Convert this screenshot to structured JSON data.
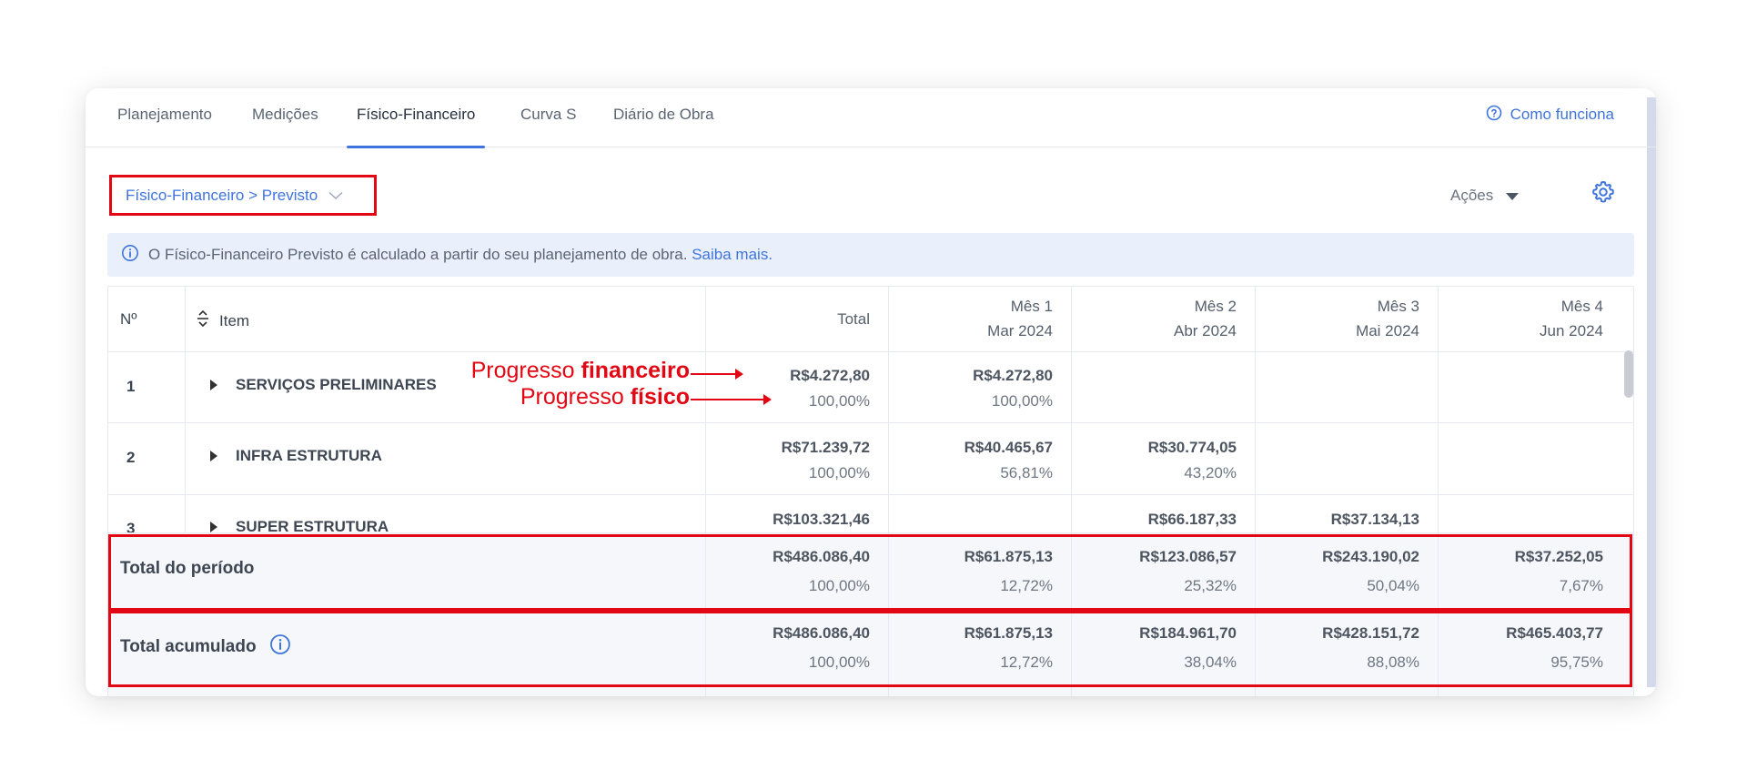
{
  "tabs": [
    {
      "label": "Planejamento"
    },
    {
      "label": "Medições"
    },
    {
      "label": "Físico-Financeiro"
    },
    {
      "label": "Curva S"
    },
    {
      "label": "Diário de Obra"
    }
  ],
  "active_tab": "Físico-Financeiro",
  "help_link": "Como funciona",
  "view_selector": "Físico-Financeiro > Previsto",
  "actions_label": "Ações",
  "banner": {
    "text": "O Físico-Financeiro Previsto é calculado a partir do seu planejamento de obra.",
    "link": "Saiba mais."
  },
  "table": {
    "headers": {
      "num": "Nº",
      "item": "Item",
      "total": "Total",
      "months": [
        {
          "line1": "Mês 1",
          "line2": "Mar 2024"
        },
        {
          "line1": "Mês 2",
          "line2": "Abr 2024"
        },
        {
          "line1": "Mês 3",
          "line2": "Mai 2024"
        },
        {
          "line1": "Mês 4",
          "line2": "Jun 2024"
        }
      ]
    },
    "rows": [
      {
        "num": "1",
        "name": "SERVIÇOS PRELIMINARES",
        "total": {
          "value": "R$4.272,80",
          "pct": "100,00%"
        },
        "months": [
          {
            "value": "R$4.272,80",
            "pct": "100,00%"
          },
          null,
          null,
          null
        ]
      },
      {
        "num": "2",
        "name": "INFRA ESTRUTURA",
        "total": {
          "value": "R$71.239,72",
          "pct": "100,00%"
        },
        "months": [
          {
            "value": "R$40.465,67",
            "pct": "56,81%"
          },
          {
            "value": "R$30.774,05",
            "pct": "43,20%"
          },
          null,
          null
        ]
      },
      {
        "num": "3",
        "name": "SUPER ESTRUTURA",
        "total": {
          "value": "R$103.321,46",
          "pct": ""
        },
        "months": [
          null,
          {
            "value": "R$66.187,33",
            "pct": ""
          },
          {
            "value": "R$37.134,13",
            "pct": ""
          },
          null
        ]
      }
    ],
    "total_period": {
      "label": "Total do período",
      "total": {
        "value": "R$486.086,40",
        "pct": "100,00%"
      },
      "months": [
        {
          "value": "R$61.875,13",
          "pct": "12,72%"
        },
        {
          "value": "R$123.086,57",
          "pct": "25,32%"
        },
        {
          "value": "R$243.190,02",
          "pct": "50,04%"
        },
        {
          "value": "R$37.252,05",
          "pct": "7,67%"
        }
      ]
    },
    "total_accum": {
      "label": "Total acumulado",
      "total": {
        "value": "R$486.086,40",
        "pct": "100,00%"
      },
      "months": [
        {
          "value": "R$61.875,13",
          "pct": "12,72%"
        },
        {
          "value": "R$184.961,70",
          "pct": "38,04%"
        },
        {
          "value": "R$428.151,72",
          "pct": "88,08%"
        },
        {
          "value": "R$465.403,77",
          "pct": "95,75%"
        }
      ]
    }
  },
  "annotations": {
    "financeiro_prefix": "Progresso ",
    "financeiro_bold": "financeiro",
    "fisico_prefix": "Progresso ",
    "fisico_bold": "físico"
  },
  "colors": {
    "accent": "#3f74dd",
    "highlight": "#e30613"
  }
}
